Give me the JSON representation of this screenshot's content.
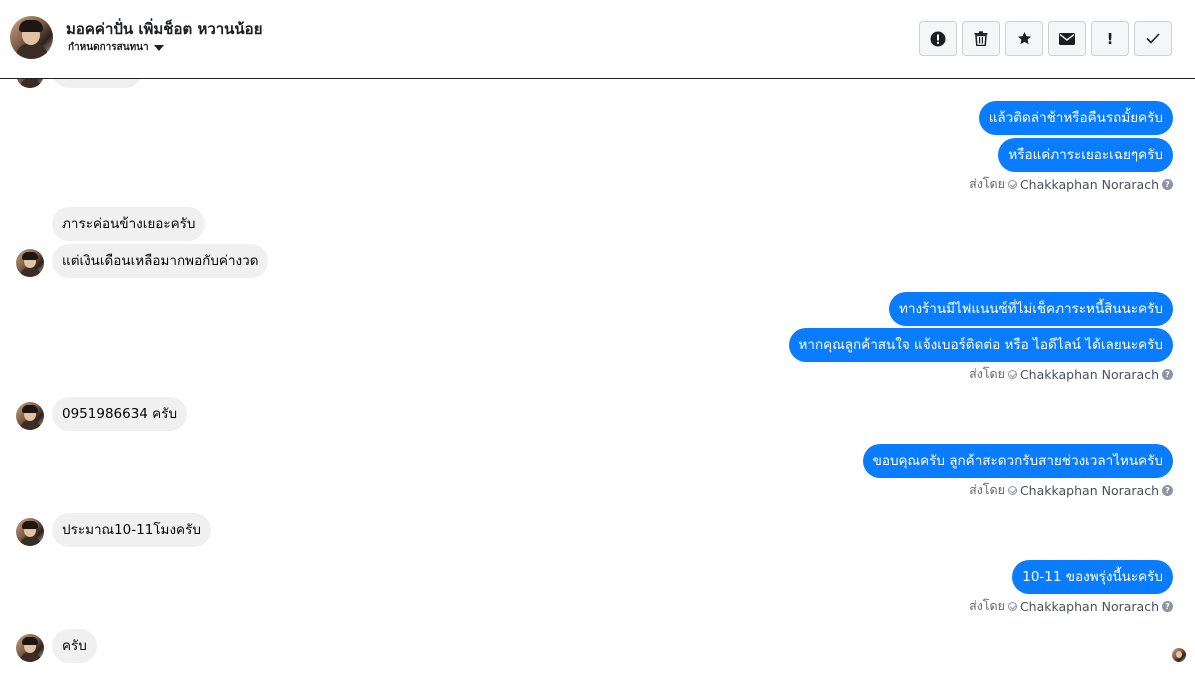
{
  "header": {
    "name": "มอคค่าปั่น เพิ่มช็อต หวานน้อย",
    "status": "กำหนดการสนทนา",
    "tools": [
      "alert-circle-icon",
      "trash-icon",
      "star-icon",
      "envelope-icon",
      "exclamation-icon",
      "check-icon"
    ]
  },
  "sent_by": {
    "label": "ส่งโดย",
    "name": "Chakkaphan Norarach",
    "help": "?"
  },
  "messages": {
    "out_1": "แล้วติดล่าช้าหรือคืนรถมั้ยครับ",
    "out_2": "หรือแค่ภาระเยอะเฉยๆครับ",
    "in_1": "ภาระค่อนข้างเยอะครับ",
    "in_2": "แต่เงินเดือนเหลือมากพอกับค่างวด",
    "out_3": "ทางร้านมีไฟแนนซ์ที่ไม่เช็คภาระหนี้สินนะครับ",
    "out_4": "หากคุณลูกค้าสนใจ แจ้งเบอร์ติดต่อ หรือ ไอดีไลน์ ได้เลยนะครับ",
    "in_3": "0951986634 ครับ",
    "out_5": "ขอบคุณครับ ลูกค้าสะดวกรับสายช่วงเวลาไหนครับ",
    "in_4": "ประมาณ10-11โมงครับ",
    "out_6": "10-11 ของพรุ่งนี้นะครับ",
    "in_5": "ครับ"
  },
  "colors": {
    "outgoing": "#0a7cff",
    "incoming": "#f0f0f0"
  }
}
